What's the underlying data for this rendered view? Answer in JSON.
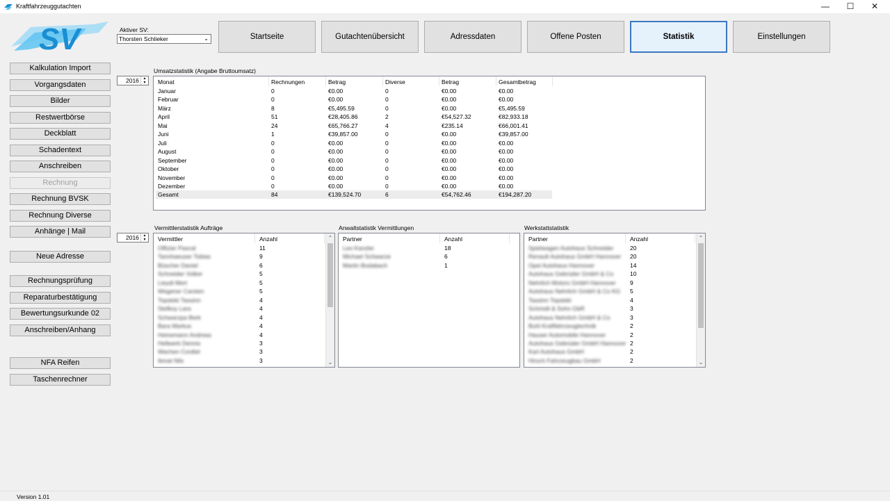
{
  "window": {
    "title": "Kraftfahrzeuggutachten",
    "controls": [
      "—",
      "☐",
      "✕"
    ]
  },
  "logo": {
    "text": "SV",
    "colors": [
      "#1a8ed3",
      "#5ec4f2",
      "#9bd9f6"
    ]
  },
  "active_sv": {
    "label": "Aktiver SV:",
    "value": "Thorsten Schlieker"
  },
  "topnav": [
    {
      "label": "Startseite"
    },
    {
      "label": "Gutachtenübersicht"
    },
    {
      "label": "Adressdaten"
    },
    {
      "label": "Offene Posten"
    },
    {
      "label": "Statistik",
      "active": true
    },
    {
      "label": "Einstellungen"
    }
  ],
  "sidebar": [
    {
      "label": "Kalkulation Import"
    },
    {
      "label": "Vorgangsdaten"
    },
    {
      "label": "Bilder"
    },
    {
      "label": "Restwertbörse"
    },
    {
      "label": "Deckblatt"
    },
    {
      "label": "Schadentext"
    },
    {
      "label": "Anschreiben"
    },
    {
      "label": "Rechnung",
      "disabled": true
    },
    {
      "label": "Rechnung BVSK"
    },
    {
      "label": "Rechnung Diverse"
    },
    {
      "label": "Anhänge | Mail"
    },
    {
      "label": "Neue Adresse"
    },
    {
      "label": "Rechnungsprüfung"
    },
    {
      "label": "Reparaturbestätigung"
    },
    {
      "label": "Bewertungsurkunde 02"
    },
    {
      "label": "Anschreiben/Anhang"
    },
    {
      "label": "NFA Reifen"
    },
    {
      "label": "Taschenrechner"
    }
  ],
  "year1": "2016",
  "year2": "2016",
  "umsatz": {
    "title": "Umsatzstatistik (Angabe Bruttoumsatz)",
    "headers": [
      "Monat",
      "Rechnungen",
      "Betrag",
      "Diverse",
      "Betrag",
      "Gesamtbetrag"
    ],
    "rows": [
      [
        "Januar",
        "0",
        "€0.00",
        "0",
        "€0.00",
        "€0.00"
      ],
      [
        "Februar",
        "0",
        "€0.00",
        "0",
        "€0.00",
        "€0.00"
      ],
      [
        "März",
        "8",
        "€5,495.59",
        "0",
        "€0.00",
        "€5,495.59"
      ],
      [
        "April",
        "51",
        "€28,405.86",
        "2",
        "€54,527.32",
        "€82,933.18"
      ],
      [
        "Mai",
        "24",
        "€65,766.27",
        "4",
        "€235.14",
        "€66,001.41"
      ],
      [
        "Juni",
        "1",
        "€39,857.00",
        "0",
        "€0.00",
        "€39,857.00"
      ],
      [
        "Juli",
        "0",
        "€0.00",
        "0",
        "€0.00",
        "€0.00"
      ],
      [
        "August",
        "0",
        "€0.00",
        "0",
        "€0.00",
        "€0.00"
      ],
      [
        "September",
        "0",
        "€0.00",
        "0",
        "€0.00",
        "€0.00"
      ],
      [
        "Oktober",
        "0",
        "€0.00",
        "0",
        "€0.00",
        "€0.00"
      ],
      [
        "November",
        "0",
        "€0.00",
        "0",
        "€0.00",
        "€0.00"
      ],
      [
        "Dezember",
        "0",
        "€0.00",
        "0",
        "€0.00",
        "€0.00"
      ],
      [
        "Gesamt",
        "84",
        "€139,524.70",
        "6",
        "€54,762.46",
        "€194,287.20"
      ]
    ]
  },
  "vermittler": {
    "title": "Vermittlerstatistik Aufträge",
    "headers": [
      "Vermittler",
      "Anzahl"
    ],
    "rows": [
      [
        "Offizier Pascal",
        "11"
      ],
      [
        "Tannhaeuser Tobias",
        "9"
      ],
      [
        "Büscher Daniel",
        "6"
      ],
      [
        "Schneider Volker",
        "5"
      ],
      [
        "Lieydt Mert",
        "5"
      ],
      [
        "Wegener Carsten",
        "5"
      ],
      [
        "Topalski Tassinn",
        "4"
      ],
      [
        "Stefkoy Lara",
        "4"
      ],
      [
        "Schwarzpa Berk",
        "4"
      ],
      [
        "Bara Markus",
        "4"
      ],
      [
        "Heinemann Andreas",
        "4"
      ],
      [
        "Hellwerk Dennis",
        "3"
      ],
      [
        "Wachen Cordtel",
        "3"
      ],
      [
        "Ikmat Nils",
        "3"
      ]
    ]
  },
  "anwalt": {
    "title": "Anwaltstatistik Vermittlungen",
    "headers": [
      "Partner",
      "Anzahl"
    ],
    "rows": [
      [
        "Leo Kanzlei",
        "18"
      ],
      [
        "Michael Schwarze",
        "6"
      ],
      [
        "Martin Bodabach",
        "1"
      ]
    ]
  },
  "werkstatt": {
    "title": "Werkstattstatistik",
    "headers": [
      "Partner",
      "Anzahl"
    ],
    "rows": [
      [
        "Spielwagen Autohaus Schneider",
        "20"
      ],
      [
        "Renault Autohaus GmbH Hannover",
        "20"
      ],
      [
        "Opel Autohaus Hannover",
        "14"
      ],
      [
        "Autohaus Gebrüder GmbH & Co",
        "10"
      ],
      [
        "Nehrlich Motors GmbH Hannover",
        "9"
      ],
      [
        "Autohaus Nehrlich GmbH & Co KG",
        "5"
      ],
      [
        "Tassinn Topalski",
        "4"
      ],
      [
        "Schmidt & Sohn GbR",
        "3"
      ],
      [
        "Autohaus Nehrlich GmbH & Co",
        "3"
      ],
      [
        "Buhl Kraftfahrzeugtechnik",
        "2"
      ],
      [
        "Hauser Automobile Hannover",
        "2"
      ],
      [
        "Autohaus Gebrüder GmbH Hannover",
        "2"
      ],
      [
        "Karl Autohaus GmbH",
        "2"
      ],
      [
        "Hirsch Fahrzeugbau GmbH",
        "2"
      ]
    ]
  },
  "status": {
    "version": "Version 1.01"
  }
}
